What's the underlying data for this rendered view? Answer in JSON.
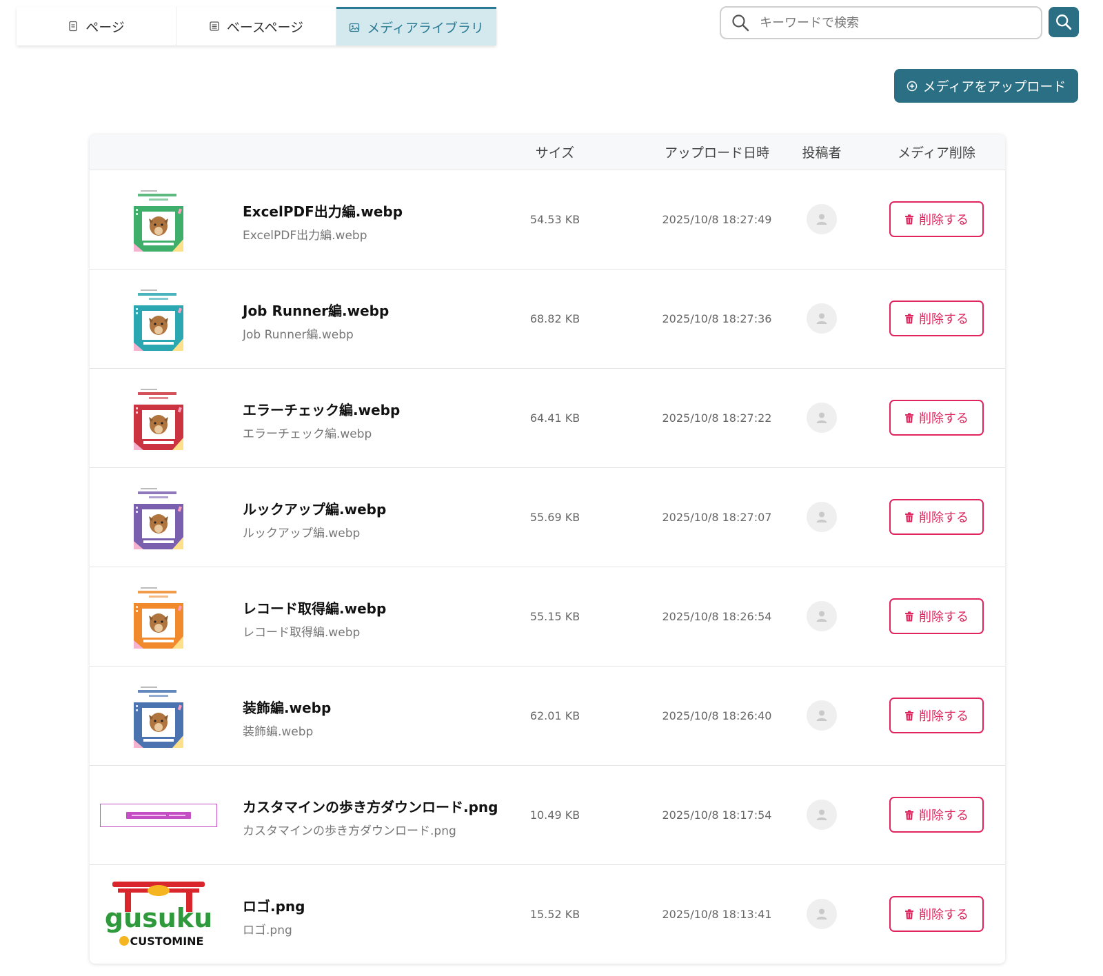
{
  "tabs": [
    {
      "label": "ページ",
      "icon": "page-icon"
    },
    {
      "label": "ベースページ",
      "icon": "base-page-icon"
    },
    {
      "label": "メディアライブラリ",
      "icon": "image-icon",
      "active": true
    }
  ],
  "search": {
    "placeholder": "キーワードで検索",
    "value": ""
  },
  "upload_button": {
    "label": "メディアをアップロード"
  },
  "table": {
    "headers": {
      "size": "サイズ",
      "uploaded_at": "アップロード日時",
      "author": "投稿者",
      "delete": "メディア削除"
    },
    "delete_label": "削除する",
    "rows": [
      {
        "title": "ExcelPDF出力編.webp",
        "filename": "ExcelPDF出力編.webp",
        "size": "54.53 KB",
        "date": "2025/10/8 18:27:49",
        "thumb_color": "#3fae6b"
      },
      {
        "title": "Job Runner編.webp",
        "filename": "Job Runner編.webp",
        "size": "68.82 KB",
        "date": "2025/10/8 18:27:36",
        "thumb_color": "#2aa7b0"
      },
      {
        "title": "エラーチェック編.webp",
        "filename": "エラーチェック編.webp",
        "size": "64.41 KB",
        "date": "2025/10/8 18:27:22",
        "thumb_color": "#cc3340"
      },
      {
        "title": "ルックアップ編.webp",
        "filename": "ルックアップ編.webp",
        "size": "55.69 KB",
        "date": "2025/10/8 18:27:07",
        "thumb_color": "#7a5fae"
      },
      {
        "title": "レコード取得編.webp",
        "filename": "レコード取得編.webp",
        "size": "55.15 KB",
        "date": "2025/10/8 18:26:54",
        "thumb_color": "#f08a2c"
      },
      {
        "title": "装飾編.webp",
        "filename": "装飾編.webp",
        "size": "62.01 KB",
        "date": "2025/10/8 18:26:40",
        "thumb_color": "#4a73b0"
      },
      {
        "title": "カスタマインの歩き方ダウンロード.png",
        "filename": "カスタマインの歩き方ダウンロード.png",
        "size": "10.49 KB",
        "date": "2025/10/8 18:17:54",
        "thumb_color": "#c44fc4"
      },
      {
        "title": "ロゴ.png",
        "filename": "ロゴ.png",
        "size": "15.52 KB",
        "date": "2025/10/8 18:13:41",
        "thumb_color": "#d8262c"
      }
    ]
  },
  "logo": {
    "top_text": "gusuku",
    "bottom_text": "CUSTOMINE"
  }
}
